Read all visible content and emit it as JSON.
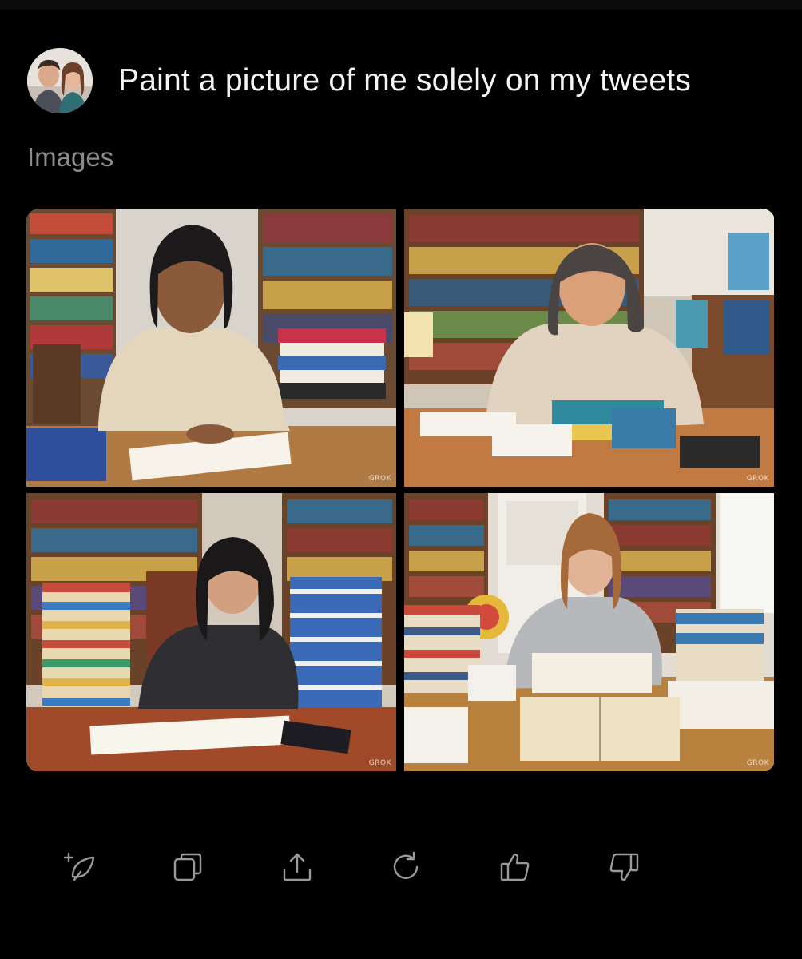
{
  "prompt": {
    "text": "Paint a picture of me solely on my tweets",
    "avatar_icon": "user-avatar"
  },
  "section": {
    "label": "Images"
  },
  "images": [
    {
      "watermark": "GROK"
    },
    {
      "watermark": "GROK"
    },
    {
      "watermark": "GROK"
    },
    {
      "watermark": "GROK"
    }
  ],
  "actions": [
    {
      "icon": "feather-plus-icon"
    },
    {
      "icon": "copy-icon"
    },
    {
      "icon": "share-icon"
    },
    {
      "icon": "regenerate-icon"
    },
    {
      "icon": "thumbs-up-icon"
    },
    {
      "icon": "thumbs-down-icon"
    }
  ],
  "colors": {
    "background": "#000000",
    "text": "#f5f5f5",
    "muted": "#8c8c8c",
    "icon": "#9a9a9a"
  }
}
